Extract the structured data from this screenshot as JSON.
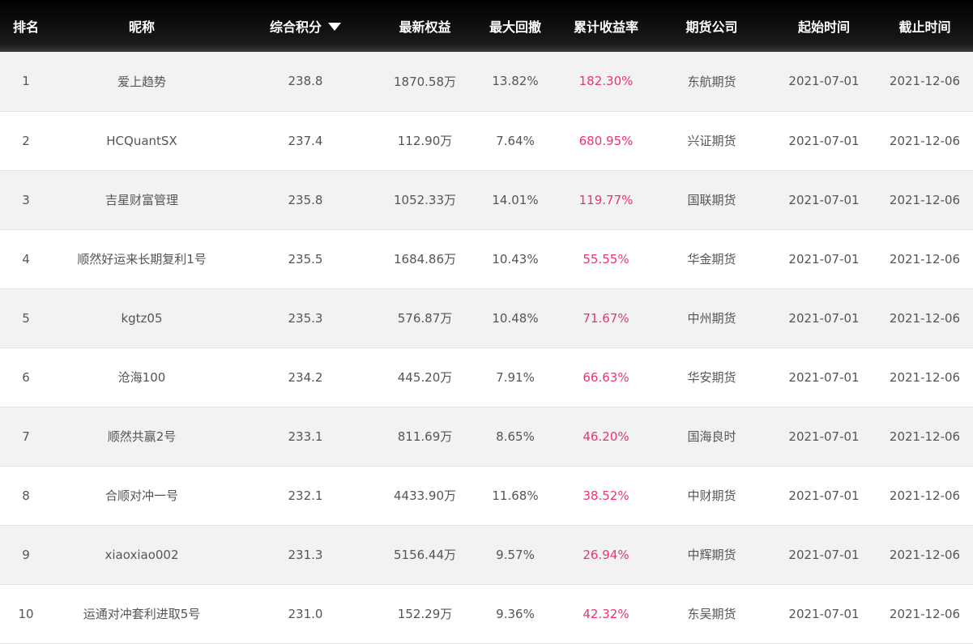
{
  "colors": {
    "header_bg": "#111111",
    "header_text": "#ffffff",
    "row_odd": "#f2f2f2",
    "row_even": "#ffffff",
    "text": "#555555",
    "return_rate": "#e8337a"
  },
  "header": {
    "rank": "排名",
    "nickname": "昵称",
    "score": "综合积分",
    "score_sort_icon": "sort-down-triangle-icon",
    "equity": "最新权益",
    "drawdown": "最大回撤",
    "return_rate": "累计收益率",
    "company": "期货公司",
    "start": "起始时间",
    "end": "截止时间"
  },
  "rows": [
    {
      "rank": "1",
      "nickname": "爱上趋势",
      "score": "238.8",
      "equity": "1870.58万",
      "drawdown": "13.82%",
      "return_rate": "182.30%",
      "company": "东航期货",
      "start": "2021-07-01",
      "end": "2021-12-06"
    },
    {
      "rank": "2",
      "nickname": "HCQuantSX",
      "score": "237.4",
      "equity": "112.90万",
      "drawdown": "7.64%",
      "return_rate": "680.95%",
      "company": "兴证期货",
      "start": "2021-07-01",
      "end": "2021-12-06"
    },
    {
      "rank": "3",
      "nickname": "吉星财富管理",
      "score": "235.8",
      "equity": "1052.33万",
      "drawdown": "14.01%",
      "return_rate": "119.77%",
      "company": "国联期货",
      "start": "2021-07-01",
      "end": "2021-12-06"
    },
    {
      "rank": "4",
      "nickname": "顺然好运来长期复利1号",
      "score": "235.5",
      "equity": "1684.86万",
      "drawdown": "10.43%",
      "return_rate": "55.55%",
      "company": "华金期货",
      "start": "2021-07-01",
      "end": "2021-12-06"
    },
    {
      "rank": "5",
      "nickname": "kgtz05",
      "score": "235.3",
      "equity": "576.87万",
      "drawdown": "10.48%",
      "return_rate": "71.67%",
      "company": "中州期货",
      "start": "2021-07-01",
      "end": "2021-12-06"
    },
    {
      "rank": "6",
      "nickname": "沧海100",
      "score": "234.2",
      "equity": "445.20万",
      "drawdown": "7.91%",
      "return_rate": "66.63%",
      "company": "华安期货",
      "start": "2021-07-01",
      "end": "2021-12-06"
    },
    {
      "rank": "7",
      "nickname": "顺然共赢2号",
      "score": "233.1",
      "equity": "811.69万",
      "drawdown": "8.65%",
      "return_rate": "46.20%",
      "company": "国海良时",
      "start": "2021-07-01",
      "end": "2021-12-06"
    },
    {
      "rank": "8",
      "nickname": "合顺对冲一号",
      "score": "232.1",
      "equity": "4433.90万",
      "drawdown": "11.68%",
      "return_rate": "38.52%",
      "company": "中财期货",
      "start": "2021-07-01",
      "end": "2021-12-06"
    },
    {
      "rank": "9",
      "nickname": "xiaoxiao002",
      "score": "231.3",
      "equity": "5156.44万",
      "drawdown": "9.57%",
      "return_rate": "26.94%",
      "company": "中辉期货",
      "start": "2021-07-01",
      "end": "2021-12-06"
    },
    {
      "rank": "10",
      "nickname": "运通对冲套利进取5号",
      "score": "231.0",
      "equity": "152.29万",
      "drawdown": "9.36%",
      "return_rate": "42.32%",
      "company": "东吴期货",
      "start": "2021-07-01",
      "end": "2021-12-06"
    }
  ]
}
